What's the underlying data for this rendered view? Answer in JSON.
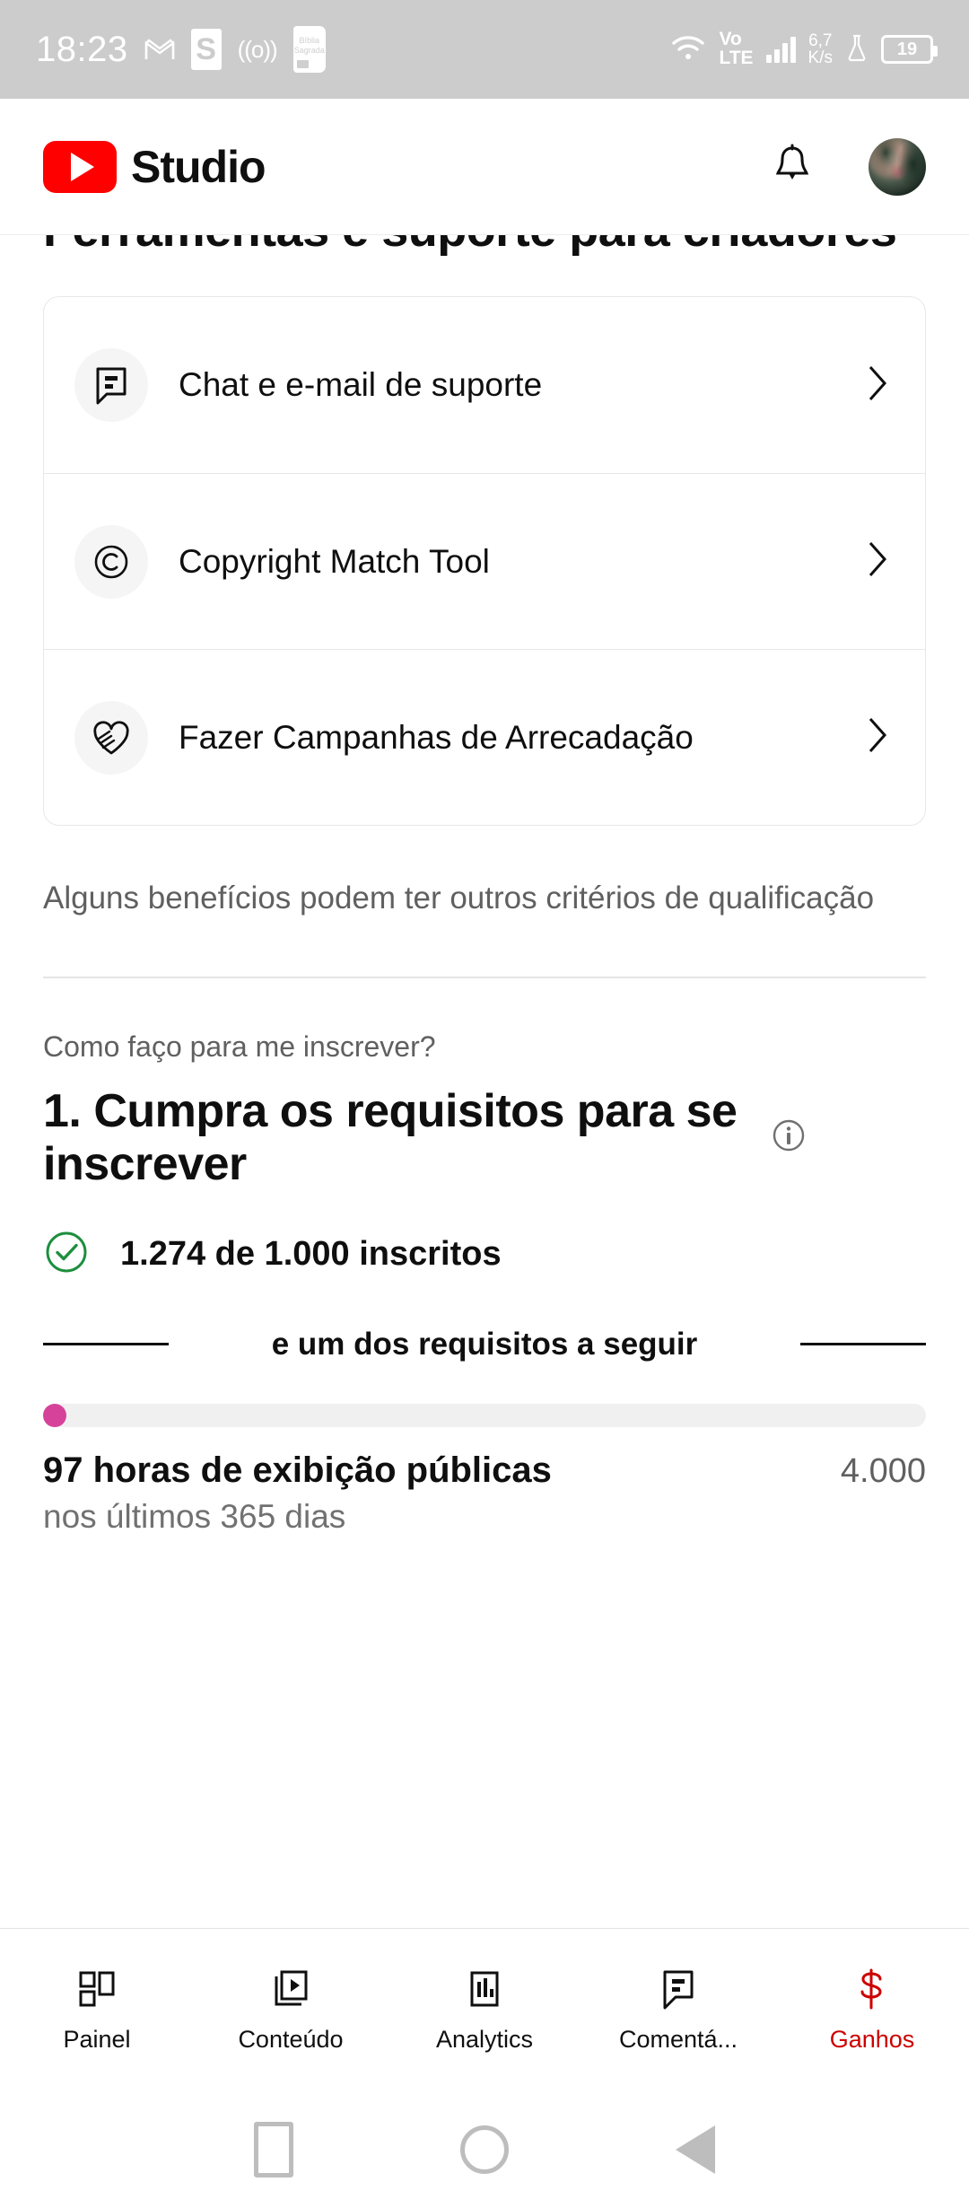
{
  "status_bar": {
    "time": "18:23",
    "icons": [
      "gmail-icon",
      "s-app-icon",
      "cast-icon",
      "bible-app-icon"
    ],
    "network_label_top": "Vo",
    "network_label_bottom": "LTE",
    "speed_top": "6,7",
    "speed_bottom": "K/s",
    "battery": "19"
  },
  "header": {
    "brand": "Studio",
    "bell": "notifications-bell",
    "avatar": "channel-avatar"
  },
  "main": {
    "page_title": "Ferramentas e suporte para criadores",
    "tools": [
      {
        "icon": "feedback-chat-icon",
        "label": "Chat e e-mail de suporte"
      },
      {
        "icon": "copyright-icon",
        "label": "Copyright Match Tool"
      },
      {
        "icon": "volunteer-heart-hands-icon",
        "label": "Fazer Campanhas de Arrecadação"
      }
    ],
    "note": "Alguns benefícios podem ter outros critérios de qualificação",
    "question": "Como faço para me inscrever?",
    "step_title": "1. Cumpra os requisitos para se inscrever",
    "info_icon": "info-icon",
    "requirement": {
      "status_icon": "check-circle-icon",
      "text": "1.274 de 1.000 inscritos"
    },
    "divider_text": "e um dos requisitos a seguir",
    "progress": {
      "percent": 2.4,
      "color": "#d6429a",
      "track_color": "#f0f0f0"
    },
    "metric": {
      "main": "97 horas de exibição públicas",
      "goal": "4.000",
      "sub": "nos últimos 365 dias"
    }
  },
  "bottom_nav": {
    "active_color": "#cc0000",
    "items": [
      {
        "icon": "dashboard-icon",
        "label": "Painel"
      },
      {
        "icon": "content-video-icon",
        "label": "Conteúdo"
      },
      {
        "icon": "analytics-bar-icon",
        "label": "Analytics"
      },
      {
        "icon": "comments-icon",
        "label": "Comentá..."
      },
      {
        "icon": "earnings-dollar-icon",
        "label": "Ganhos"
      }
    ],
    "active_index": 4
  },
  "system_nav": {
    "recents": "recents-square-icon",
    "home": "home-circle-icon",
    "back": "back-triangle-icon"
  }
}
